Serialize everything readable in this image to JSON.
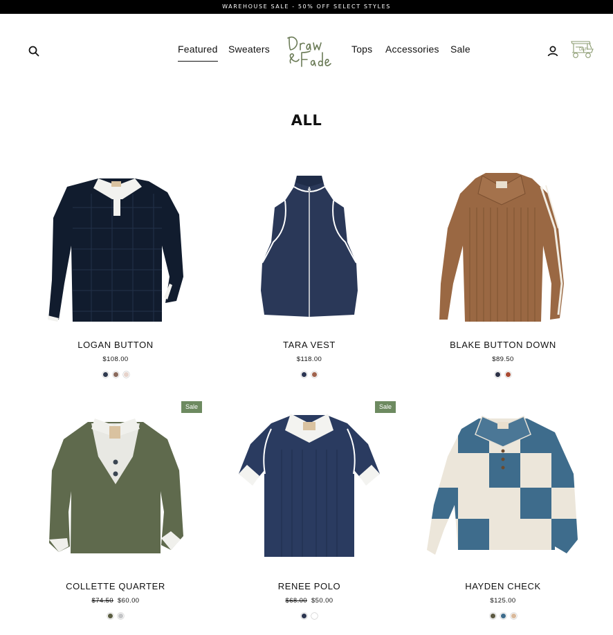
{
  "announcement": "WAREHOUSE SALE - 50% OFF SELECT STYLES",
  "header": {
    "nav": [
      "Featured",
      "Sweaters",
      "Tops",
      "Accessories",
      "Sale"
    ],
    "logo_text": "Draw & Fade"
  },
  "page_title": "ALL",
  "colors": {
    "announcement_bg": "#000000",
    "sale_badge": "#6d8a60"
  },
  "products": [
    {
      "name": "LOGAN BUTTON",
      "price": "$108.00",
      "old_price": "",
      "sale": false,
      "swatches": [
        "#2f3a4f",
        "#8a6a5c",
        "#e6d3cb"
      ]
    },
    {
      "name": "TARA VEST",
      "price": "$118.00",
      "old_price": "",
      "sale": false,
      "swatches": [
        "#2b3552",
        "#a0634d"
      ]
    },
    {
      "name": "BLAKE BUTTON DOWN",
      "price": "$89.50",
      "old_price": "",
      "sale": false,
      "swatches": [
        "#2c3146",
        "#a94a32"
      ]
    },
    {
      "name": "COLLETTE QUARTER",
      "price": "$60.00",
      "old_price": "$74.50",
      "sale": true,
      "badge": "Sale",
      "swatches": [
        "#5b5e42",
        "#c3c4c6"
      ]
    },
    {
      "name": "RENEE POLO",
      "price": "$50.00",
      "old_price": "$68.00",
      "sale": true,
      "badge": "Sale",
      "swatches": [
        "#2c3550",
        "#ffffff"
      ]
    },
    {
      "name": "HAYDEN CHECK",
      "price": "$125.00",
      "old_price": "",
      "sale": false,
      "swatches": [
        "#5d5a43",
        "#3e6c8c",
        "#d9b99b"
      ]
    }
  ]
}
